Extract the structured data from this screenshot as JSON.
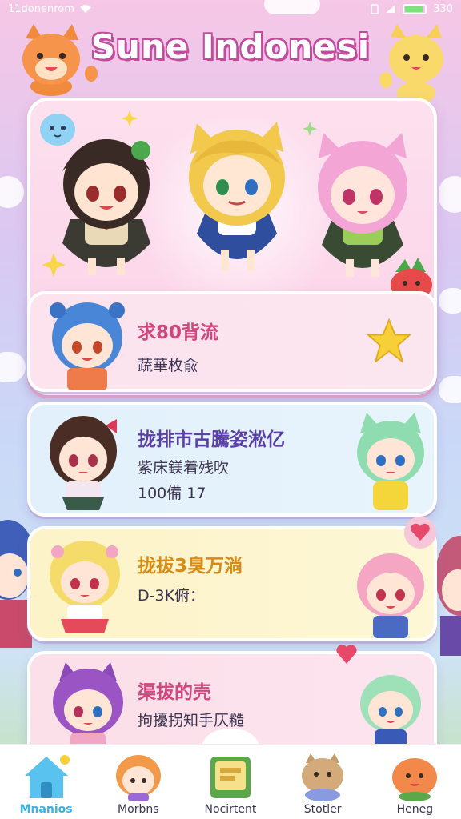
{
  "status_bar": {
    "carrier": "11donenrom",
    "battery_text": "330"
  },
  "app": {
    "title": "Sune Indonesi"
  },
  "cards": [
    {
      "title": "求80背流",
      "subtitle": "蔬華枚兪",
      "meta": "",
      "title_color": "#d2467e",
      "bg": "#fbe0ec"
    },
    {
      "title": "拢排市古騰姿淞亿",
      "subtitle": "紫床鎂着残吹",
      "meta": "100備 17",
      "title_color": "#5a3fa8",
      "bg": "#e4f1fb"
    },
    {
      "title": "拢拔3臭万淌",
      "subtitle": "D-3K俯：",
      "meta": "",
      "title_color": "#d98a12",
      "bg": "#fdf5cf"
    },
    {
      "title": "渠拔的壳",
      "subtitle": "拘擾拐知手仄糙",
      "meta": "",
      "title_color": "#d2467e",
      "bg": "#fbe0ec"
    }
  ],
  "nav": {
    "items": [
      {
        "label": "Mnanios",
        "icon": "home-icon",
        "active": true
      },
      {
        "label": "Morbns",
        "icon": "character-icon",
        "active": false
      },
      {
        "label": "Nocirtent",
        "icon": "book-icon",
        "active": false
      },
      {
        "label": "Stotler",
        "icon": "pet-icon",
        "active": false
      },
      {
        "label": "Heneg",
        "icon": "mascot-icon",
        "active": false
      }
    ]
  },
  "colors": {
    "accent": "#3bb2e6",
    "title_outline": "#c14b9c"
  }
}
